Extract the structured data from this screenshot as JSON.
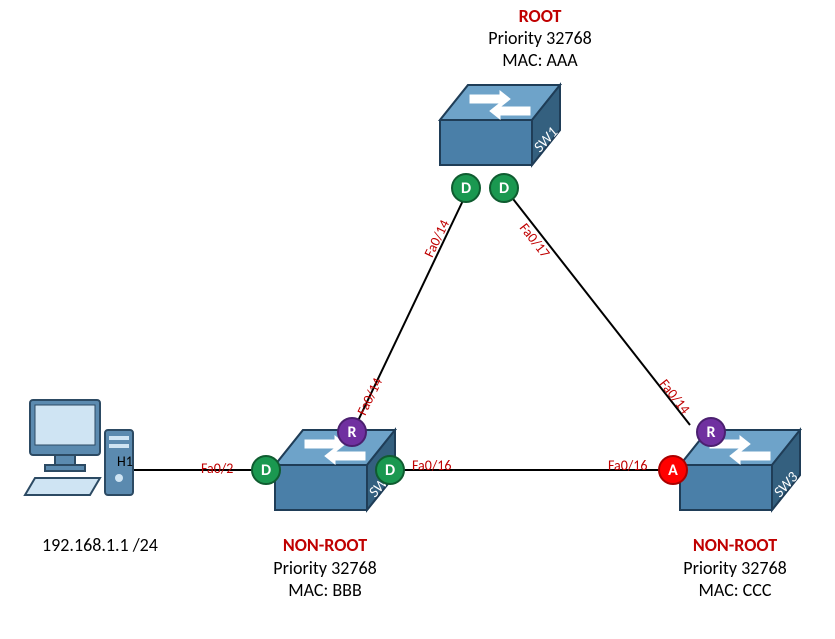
{
  "sw1": {
    "role": "ROOT",
    "priority_label": "Priority 32768",
    "mac_label": "MAC: AAA",
    "name": "SW1",
    "ports": {
      "left": {
        "state": "D",
        "if": "Fa0/14"
      },
      "right": {
        "state": "D",
        "if": "Fa0/17"
      }
    }
  },
  "sw2": {
    "role": "NON-ROOT",
    "priority_label": "Priority 32768",
    "mac_label": "MAC: BBB",
    "name": "SW2",
    "ports": {
      "up": {
        "state": "R",
        "if": "Fa0/14"
      },
      "right": {
        "state": "D",
        "if": "Fa0/16"
      },
      "left": {
        "state": "D",
        "if": "Fa0/2"
      }
    }
  },
  "sw3": {
    "role": "NON-ROOT",
    "priority_label": "Priority 32768",
    "mac_label": "MAC: CCC",
    "name": "SW3",
    "ports": {
      "up": {
        "state": "R",
        "if": "Fa0/14"
      },
      "left": {
        "state": "A",
        "if": "Fa0/16"
      }
    }
  },
  "host": {
    "name": "H1",
    "ip": "192.168.1.1 /24"
  }
}
